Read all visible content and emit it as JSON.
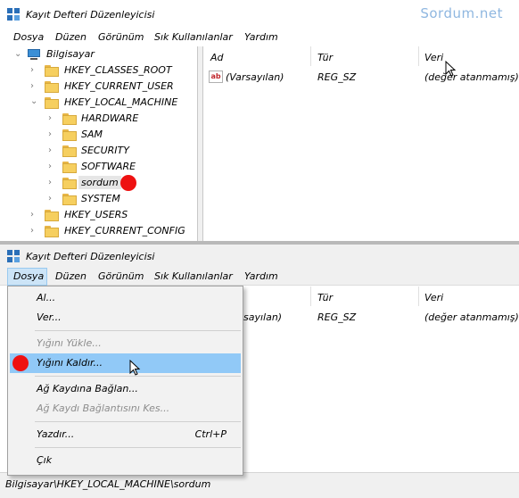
{
  "watermark": "Sordum.net",
  "window1": {
    "title": "Kayıt Defteri Düzenleyicisi",
    "menu": [
      "Dosya",
      "Düzen",
      "Görünüm",
      "Sık Kullanılanlar",
      "Yardım"
    ],
    "tree": {
      "root": "Bilgisayar",
      "hives": [
        "HKEY_CLASSES_ROOT",
        "HKEY_CURRENT_USER",
        "HKEY_LOCAL_MACHINE"
      ],
      "hklm_children": [
        "HARDWARE",
        "SAM",
        "SECURITY",
        "SOFTWARE",
        "sordum",
        "SYSTEM"
      ],
      "more_hives": [
        "HKEY_USERS",
        "HKEY_CURRENT_CONFIG"
      ]
    },
    "columns": [
      "Ad",
      "Tür",
      "Veri"
    ],
    "rows": [
      {
        "name": "(Varsayılan)",
        "type": "REG_SZ",
        "data": "(değer atanmamış)"
      }
    ],
    "value_icon_text": "ab"
  },
  "window2": {
    "title": "Kayıt Defteri Düzenleyicisi",
    "menu": [
      "Dosya",
      "Düzen",
      "Görünüm",
      "Sık Kullanılanlar",
      "Yardım"
    ],
    "columns": [
      "Tür",
      "Veri"
    ],
    "row_partial": {
      "name": "sayılan)",
      "type": "REG_SZ",
      "data": "(değer atanmamış)"
    },
    "file_menu": {
      "import": "Al...",
      "export": "Ver...",
      "load_hive": "Yığını Yükle...",
      "unload_hive": "Yığını Kaldır...",
      "connect": "Ağ Kaydına Bağlan...",
      "disconnect": "Ağ Kaydı Bağlantısını Kes...",
      "print": "Yazdır...",
      "print_shortcut": "Ctrl+P",
      "exit": "Çık"
    },
    "status": "Bilgisayar\\HKEY_LOCAL_MACHINE\\sordum"
  },
  "colors": {
    "marker": "#ee1111",
    "highlight": "#91c9f7",
    "folder": "#f6cf5f",
    "watermark": "#8fb7e0"
  }
}
